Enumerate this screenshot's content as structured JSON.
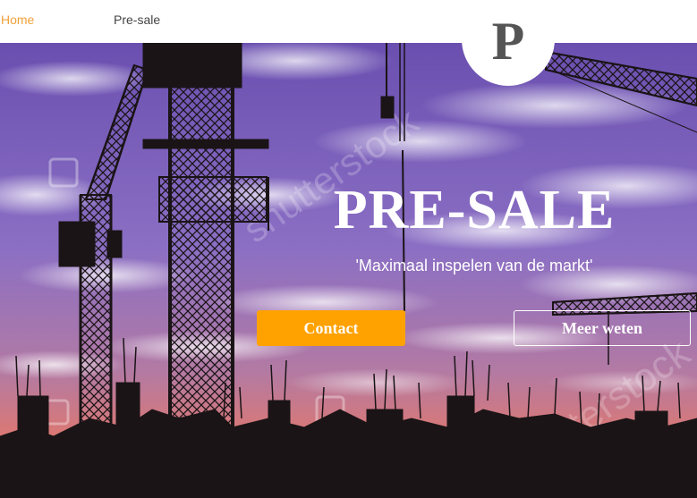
{
  "nav": {
    "items": [
      {
        "label": "Home",
        "color": "#f0a13a"
      },
      {
        "label": "Pre-sale",
        "color": "#444444"
      }
    ]
  },
  "logo": {
    "letter": "P"
  },
  "hero": {
    "title": "PRE-SALE",
    "subtitle": "'Maximaal inspelen van de markt'",
    "buttons": {
      "contact": "Contact",
      "more": "Meer weten"
    },
    "watermark": "shutterstock",
    "colors": {
      "sky_top": "#6a4fb0",
      "sky_mid": "#8b6fc4",
      "sky_low": "#b27aa4",
      "horizon": "#e0786e",
      "silhouette": "#1a1416",
      "accent": "#ffa200"
    }
  }
}
